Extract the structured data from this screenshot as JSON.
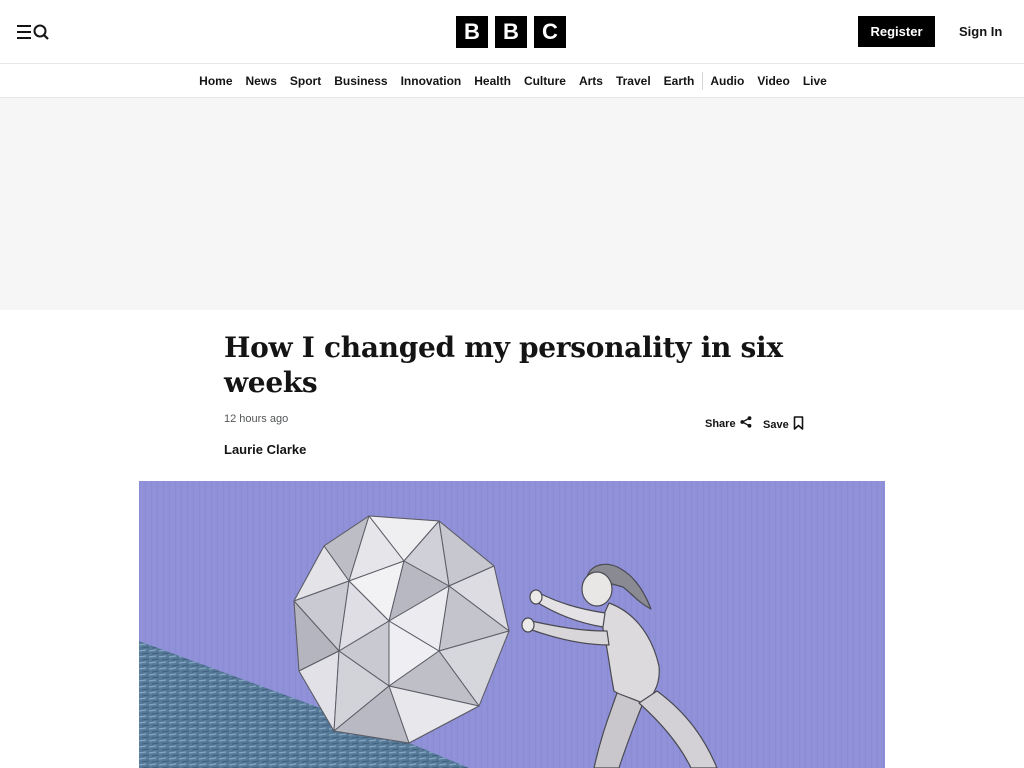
{
  "header": {
    "menu_icon": "menu-search-icon",
    "logo_letters": [
      "B",
      "B",
      "C"
    ],
    "register_label": "Register",
    "signin_label": "Sign In"
  },
  "nav": {
    "items": [
      "Home",
      "News",
      "Sport",
      "Business",
      "Innovation",
      "Health",
      "Culture",
      "Arts",
      "Travel",
      "Earth",
      "Audio",
      "Video",
      "Live"
    ]
  },
  "article": {
    "headline": "How I changed my personality in six weeks",
    "timestamp": "12 hours ago",
    "author": "Laurie Clarke",
    "share_label": "Share",
    "save_label": "Save",
    "share_icon": "share-icon",
    "save_icon": "bookmark-icon"
  },
  "hero": {
    "background_color": "#8e8fd6"
  }
}
